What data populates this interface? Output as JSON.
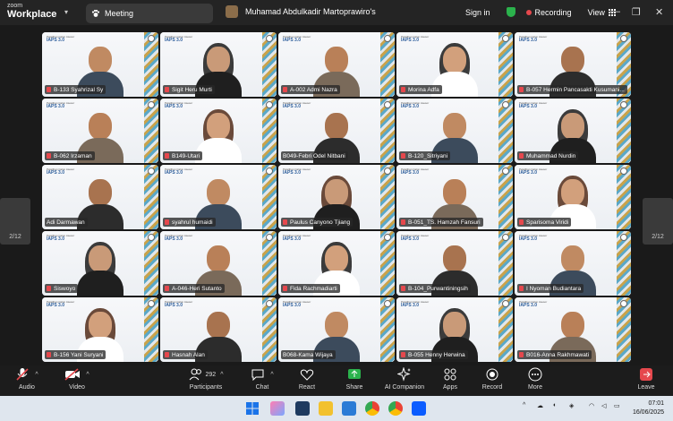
{
  "titlebar": {
    "brand_top": "zoom",
    "brand_main": "Workplace",
    "tab_label": "Meeting",
    "host_name": "Muhamad Abdulkadir Martoprawiro's",
    "sign_in": "Sign in",
    "recording": "Recording",
    "view": "View"
  },
  "pager": {
    "left": "2/12",
    "right": "2/12"
  },
  "tile_logo": {
    "line1": "Pelatihan Calon Asesor",
    "line2": "IAPS 3.0"
  },
  "participants": [
    {
      "name": "B-133 Syahrizal Sy",
      "muted": true
    },
    {
      "name": "Sigit Heru Murti",
      "muted": true
    },
    {
      "name": "A-002 Admi Nazra",
      "muted": true
    },
    {
      "name": "Morina Adfa",
      "muted": true
    },
    {
      "name": "B-057 Hermin Pancasakti Kusumani...",
      "muted": true
    },
    {
      "name": "B-062 Irzaman",
      "muted": true
    },
    {
      "name": "B149-Utari",
      "muted": true
    },
    {
      "name": "B049-Febri Odel Nitbani",
      "muted": false
    },
    {
      "name": "B-120_Sitriyani",
      "muted": true
    },
    {
      "name": "Muhammad Nurdin",
      "muted": true
    },
    {
      "name": "Adi Darmawan",
      "muted": false
    },
    {
      "name": "syahrul humaidi",
      "muted": true
    },
    {
      "name": "Paulus Canyono Tjiang",
      "muted": true
    },
    {
      "name": "B-051_TS. Hamzah Fansuri",
      "muted": true
    },
    {
      "name": "Sparisoma Viridi",
      "muted": true
    },
    {
      "name": "Siswoyo",
      "muted": true
    },
    {
      "name": "A-046-Heri Sutanto",
      "muted": true
    },
    {
      "name": "Fida Rachmadiarti",
      "muted": true
    },
    {
      "name": "B-104_Purwantiningsih",
      "muted": true
    },
    {
      "name": "I Nyoman Budiantara",
      "muted": true
    },
    {
      "name": "B-156 Yani Suryani",
      "muted": true
    },
    {
      "name": "Hasnah Alan",
      "muted": true
    },
    {
      "name": "B068-Kama Wijaya",
      "muted": false
    },
    {
      "name": "B-055 Henny Herwina",
      "muted": true
    },
    {
      "name": "B016-Anna Rakhmawati",
      "muted": true
    }
  ],
  "toolbar": {
    "audio": "Audio",
    "video": "Video",
    "participants": "Participants",
    "participant_count": "292",
    "chat": "Chat",
    "react": "React",
    "share": "Share",
    "ai_companion": "AI Companion",
    "apps": "Apps",
    "record": "Record",
    "more": "More",
    "leave": "Leave"
  },
  "taskbar": {
    "time": "07:01",
    "date": "16/06/2025"
  },
  "colors": {
    "accent": "#0b5cff",
    "mute": "#e5484d",
    "share": "#2bb24c",
    "taskbar": "#dfe6ee"
  }
}
